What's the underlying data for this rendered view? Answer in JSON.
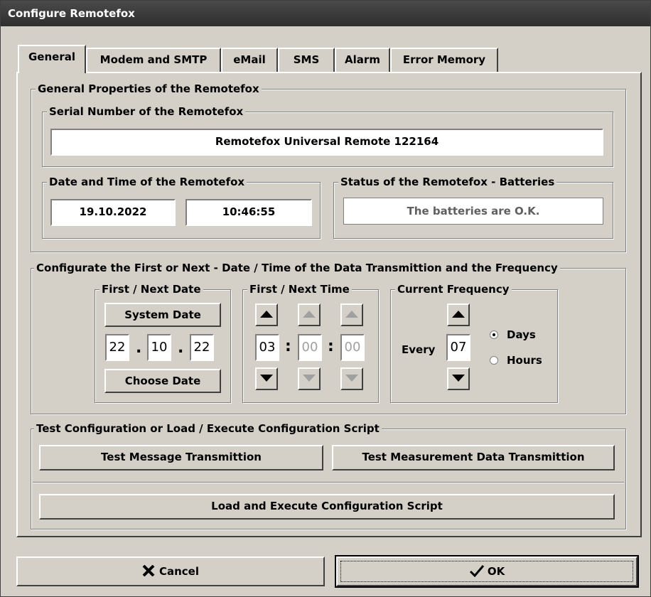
{
  "window": {
    "title": "Configure Remotefox"
  },
  "tabs": [
    {
      "label": "General",
      "active": true
    },
    {
      "label": "Modem and SMTP"
    },
    {
      "label": "eMail"
    },
    {
      "label": "SMS"
    },
    {
      "label": "Alarm"
    },
    {
      "label": "Error Memory"
    }
  ],
  "general": {
    "legend": "General Properties of the Remotefox",
    "serial": {
      "legend": "Serial Number of the Remotefox",
      "value": "Remotefox Universal Remote 122164"
    },
    "datetime": {
      "legend": "Date and Time of the Remotefox",
      "date": "19.10.2022",
      "time": "10:46:55"
    },
    "battery": {
      "legend": "Status of the Remotefox - Batteries",
      "status": "The batteries are O.K."
    }
  },
  "transmission": {
    "legend": "Configurate the First or Next - Date / Time of the Data Transmittion and the Frequency",
    "date": {
      "legend": "First / Next Date",
      "system_date_label": "System Date",
      "day": "22",
      "month": "10",
      "year": "22",
      "separator": ".",
      "choose_date_label": "Choose Date"
    },
    "time": {
      "legend": "First / Next Time",
      "hour": "03",
      "minute": "00",
      "second": "00",
      "separator": ":"
    },
    "frequency": {
      "legend": "Current Frequency",
      "prefix": "Every",
      "value": "07",
      "options": [
        "Days",
        "Hours"
      ],
      "selected": "Days"
    }
  },
  "test": {
    "legend": "Test Configuration or Load / Execute Configuration Script",
    "message_label": "Test Message Transmittion",
    "measurement_label": "Test Measurement Data Transmittion",
    "script_label": "Load and Execute Configuration Script"
  },
  "footer": {
    "cancel_label": "Cancel",
    "ok_label": "OK"
  },
  "icons": {
    "cancel": "x-icon",
    "ok": "checkmark-icon",
    "up": "arrow-up-icon",
    "down": "arrow-down-icon"
  }
}
